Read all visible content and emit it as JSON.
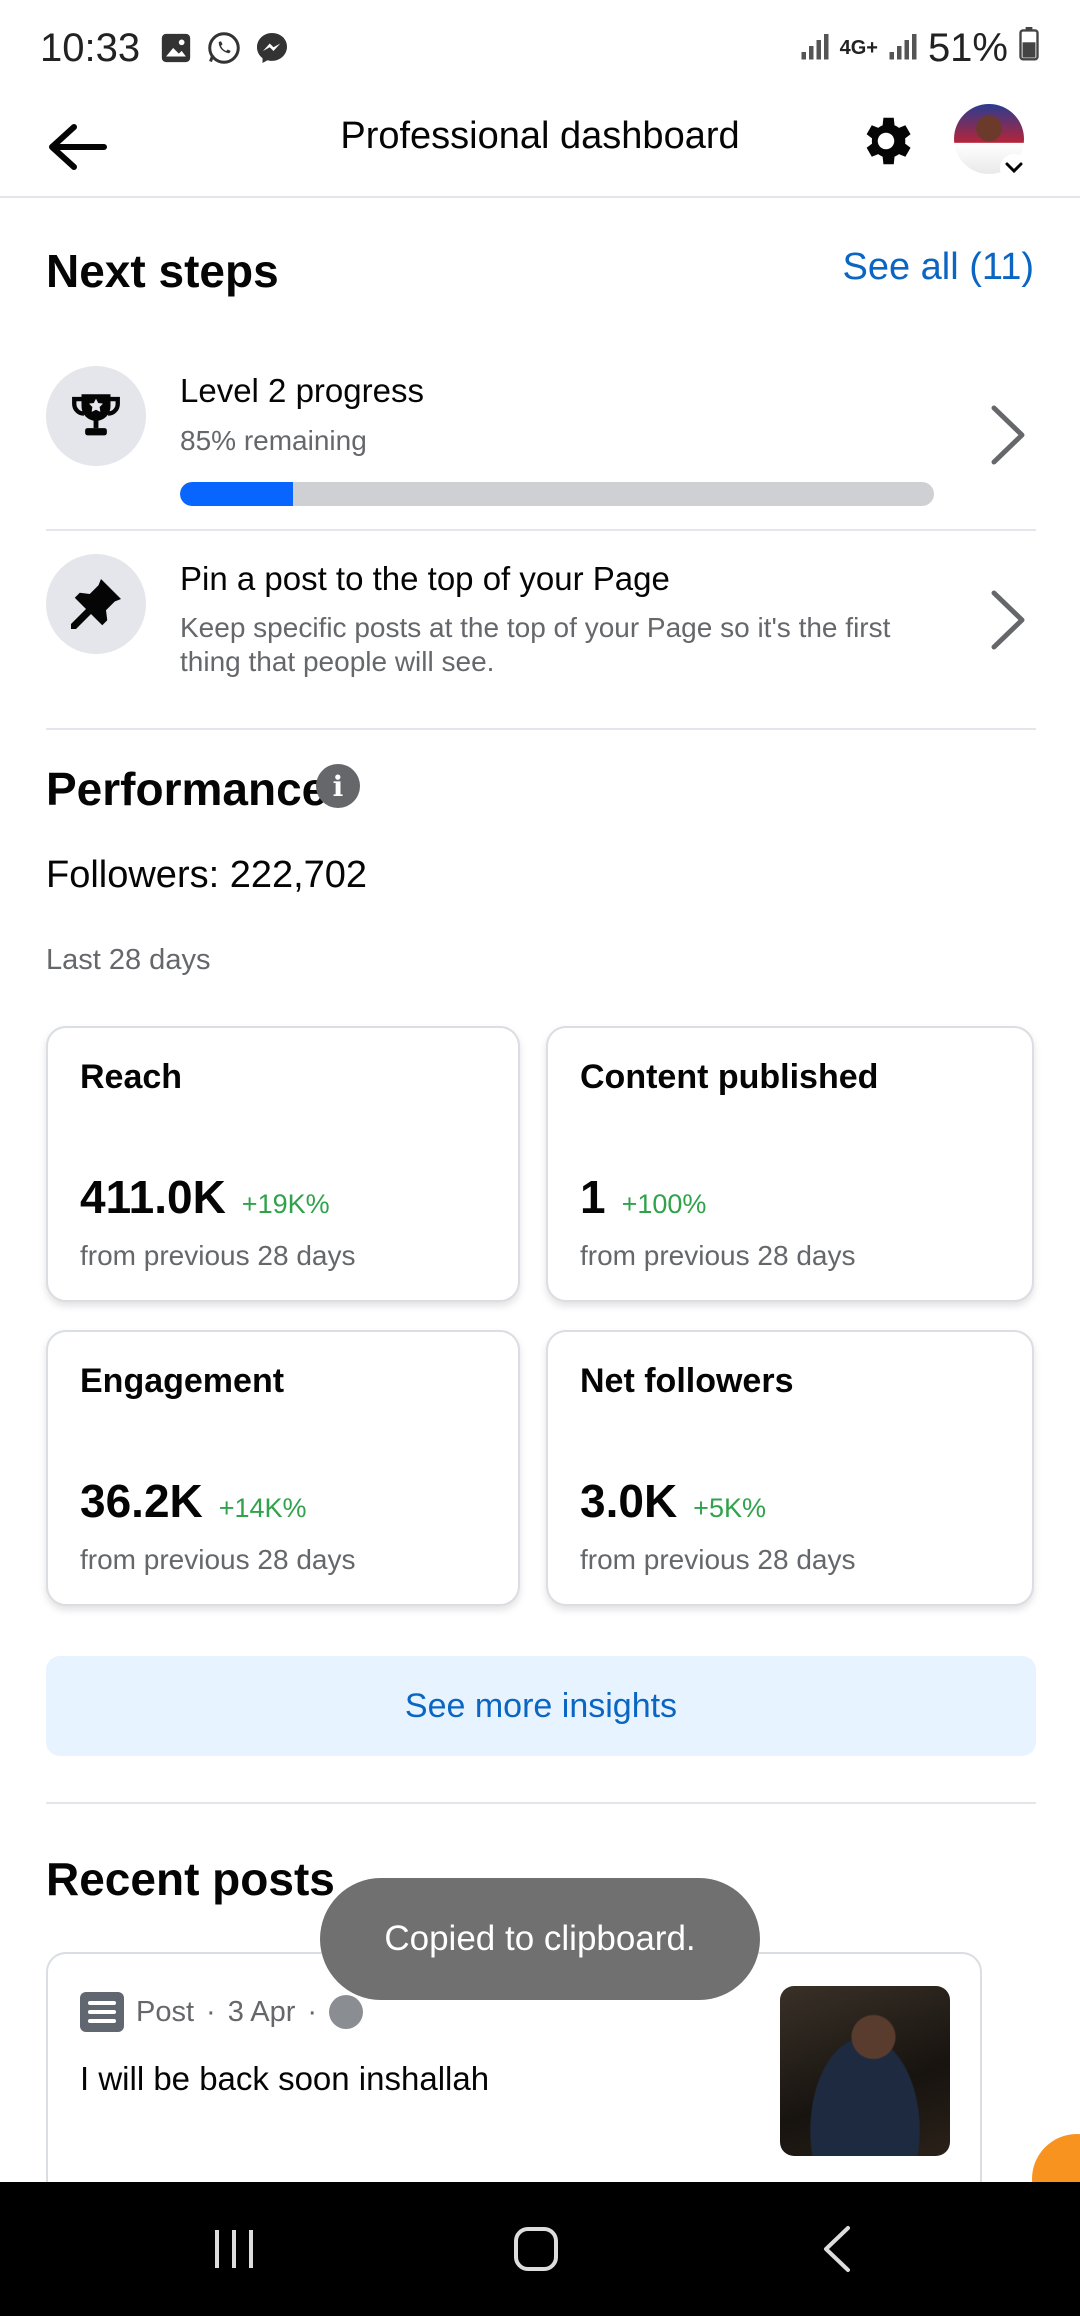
{
  "status_bar": {
    "time": "10:33",
    "network": "4G+",
    "battery": "51%",
    "notification_icons": [
      "gallery-icon",
      "whatsapp-icon",
      "messenger-icon"
    ]
  },
  "header": {
    "title": "Professional dashboard"
  },
  "next_steps": {
    "title": "Next steps",
    "see_all": "See all (11)",
    "items": [
      {
        "icon": "trophy-icon",
        "title": "Level 2 progress",
        "subtitle": "85% remaining",
        "progress": 0.15
      },
      {
        "icon": "pin-icon",
        "title": "Pin a post to the top of your Page",
        "subtitle_line1": "Keep specific posts at the top of your Page so it's the first",
        "subtitle_line2": "thing that people will see."
      }
    ]
  },
  "performance": {
    "title": "Performance",
    "info_glyph": "i",
    "followers": "Followers: 222,702",
    "period": "Last 28 days",
    "cards": [
      {
        "title": "Reach",
        "value": "411.0K",
        "delta": "+19K%",
        "sub": "from previous 28 days"
      },
      {
        "title": "Content published",
        "value": "1",
        "delta": "+100%",
        "sub": "from previous 28 days"
      },
      {
        "title": "Engagement",
        "value": "36.2K",
        "delta": "+14K%",
        "sub": "from previous 28 days"
      },
      {
        "title": "Net followers",
        "value": "3.0K",
        "delta": "+5K%",
        "sub": "from previous 28 days"
      }
    ],
    "insights_button": "See more insights"
  },
  "recent_posts": {
    "title": "Recent posts",
    "posts": [
      {
        "type": "Post",
        "date": "3 Apr",
        "separator": "·",
        "text": "I will be back soon inshallah"
      }
    ]
  },
  "toast": "Copied to clipboard.",
  "colors": {
    "accent": "#0866ff",
    "link": "#0a66c2",
    "positive": "#31a24c",
    "insights_bg": "#e7f3ff"
  }
}
